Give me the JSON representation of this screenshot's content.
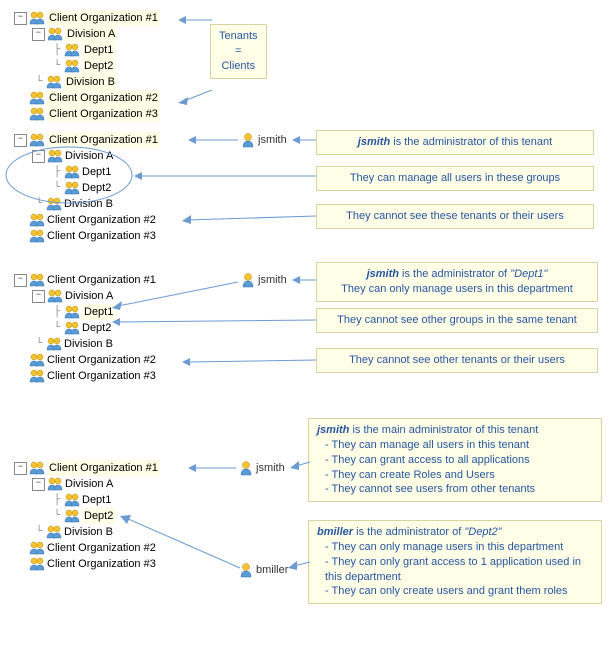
{
  "icons": {
    "expand": "−",
    "collapse": "+"
  },
  "tree": {
    "org1": "Client Organization #1",
    "org2": "Client Organization #2",
    "org3": "Client Organization #3",
    "divA": "Division A",
    "divB": "Division B",
    "dept1": "Dept1",
    "dept2": "Dept2"
  },
  "users": {
    "jsmith": "jsmith",
    "bmiller": "bmiller"
  },
  "callouts": {
    "s1": "Tenants\n=\nClients",
    "s2a_b": "jsmith",
    "s2a_t": " is the administrator of this tenant",
    "s2b": "They can manage all users in these groups",
    "s2c": "They cannot see these tenants or their users",
    "s3a_b": "jsmith",
    "s3a_t": " is the administrator of ",
    "s3a_q": "\"Dept1\"",
    "s3a_l2": "They can only manage users in this department",
    "s3b": "They cannot see other groups in the same tenant",
    "s3c": "They cannot see other tenants or their users",
    "s4a_b": "jsmith",
    "s4a_t": " is the main administrator of this tenant",
    "s4a_l1": "- They can manage all users in this tenant",
    "s4a_l2": "- They can grant access to all applications",
    "s4a_l3": "- They can create Roles and Users",
    "s4a_l4": "- They cannot see users from other tenants",
    "s4b_b": "bmiller",
    "s4b_t": " is the administrator of ",
    "s4b_q": "\"Dept2\"",
    "s4b_l1": "- They can only manage users in this department",
    "s4b_l2": "- They can only grant access to 1 application used in this department",
    "s4b_l3": "- They can only create users and grant them roles"
  }
}
